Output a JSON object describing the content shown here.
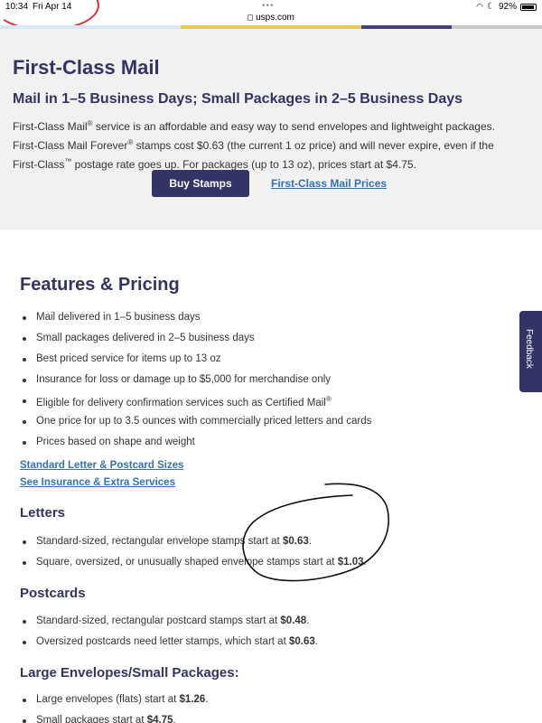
{
  "status_bar": {
    "time": "10:34",
    "date": "Fri Apr 14",
    "url": "usps.com",
    "battery": "92%",
    "battery_level": 0.92
  },
  "banner_colors": [
    "#d9e6f5",
    "#d9e6f5",
    "#e4c94b",
    "#e4c94b",
    "#4b3d7a",
    "#c8c8c8"
  ],
  "hero": {
    "title": "First-Class Mail",
    "subtitle": "Mail in 1–5 Business Days; Small Packages in 2–5 Business Days",
    "desc_1": "First-Class Mail",
    "reg": "®",
    "desc_2": " service is an affordable and easy way to send envelopes and lightweight packages. First-Class Mail Forever",
    "desc_3": " stamps cost $0.63 (the current 1 oz price) and will never expire, even if the First-Class",
    "tm": "™",
    "desc_4": " postage rate goes up. For packages (up to 13 oz), prices start at $4.75.",
    "buy_button": "Buy Stamps",
    "prices_link": "First-Class Mail Prices"
  },
  "features": {
    "heading": "Features & Pricing",
    "items": [
      "Mail delivered in 1–5 business days",
      "Small packages delivered in 2–5 business days",
      "Best priced service for items up to 13 oz",
      "Insurance for loss or damage up to $5,000 for merchandise only",
      "Eligible for delivery confirmation services such as Certified Mail",
      "One price for up to 3.5 ounces with commercially priced letters and cards",
      "Prices based on shape and weight"
    ],
    "reg": "®",
    "link_sizes": "Standard Letter & Postcard Sizes",
    "link_insurance": "See Insurance & Extra Services"
  },
  "letters": {
    "heading": "Letters",
    "item1_text": "Standard-sized, rectangular envelope stamps start at ",
    "item1_price": "$0.63",
    "item2_text": "Square, oversized, or unusually shaped envelope stamps start at ",
    "item2_price": "$1.03"
  },
  "postcards": {
    "heading": "Postcards",
    "item1_text": "Standard-sized, rectangular postcard stamps start at ",
    "item1_price": "$0.48",
    "item2_text": "Oversized postcards need letter stamps, which start at ",
    "item2_price": "$0.63"
  },
  "large": {
    "heading": "Large Envelopes/Small Packages:",
    "item1_text": "Large envelopes (flats) start at ",
    "item1_price": "$1.26",
    "item2_text": "Small packages start at ",
    "item2_price": "$4.75"
  },
  "feedback_label": "Feedback",
  "period": "."
}
